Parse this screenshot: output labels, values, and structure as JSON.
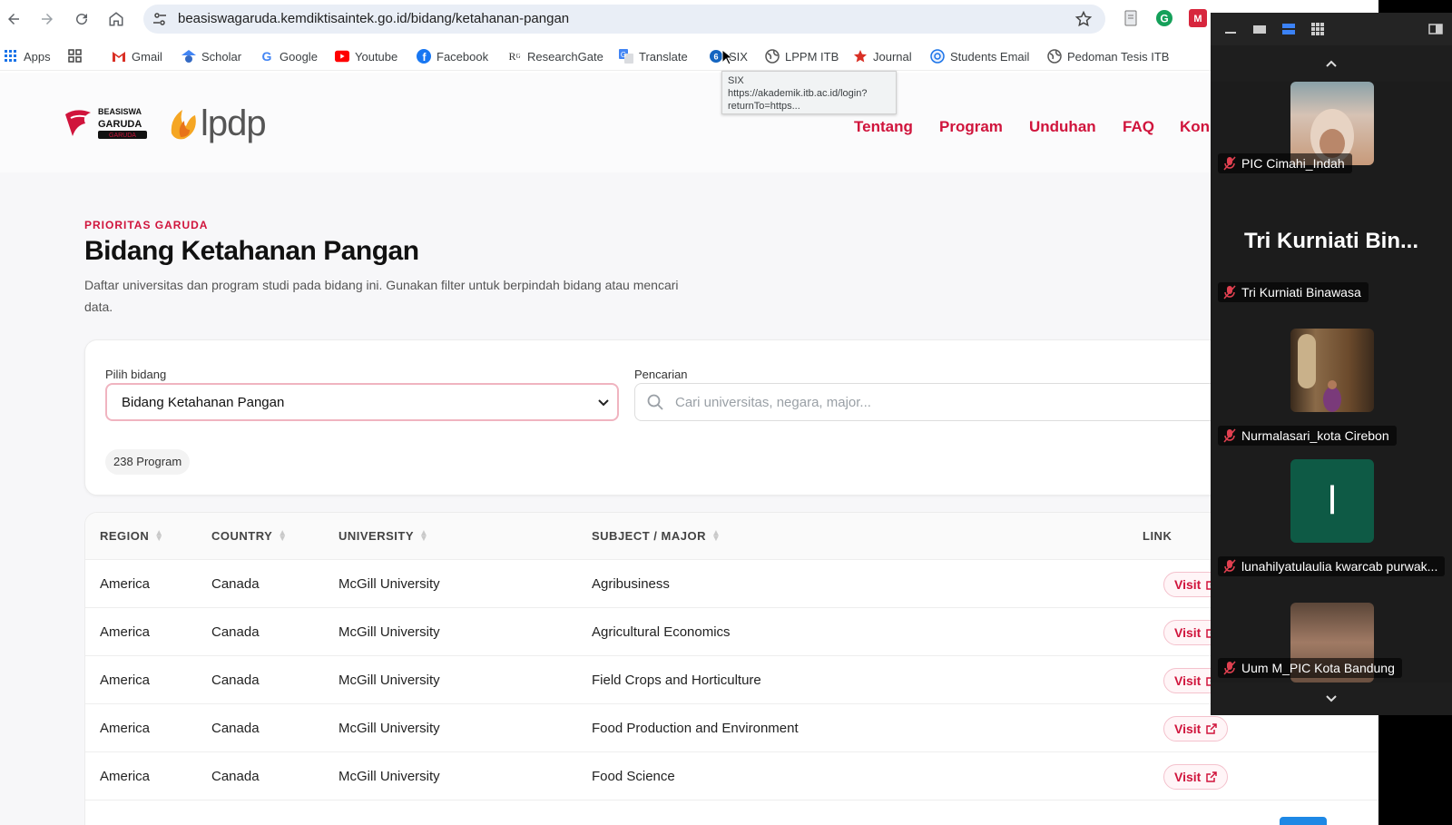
{
  "browser": {
    "url": "beasiswagaruda.kemdiktisaintek.go.id/bidang/ketahanan-pangan",
    "bookmarks": [
      {
        "label": "Apps",
        "icon": "apps-grid-icon"
      },
      {
        "label": "",
        "icon": "tab-groups-icon"
      },
      {
        "label": "Gmail",
        "icon": "gmail-icon"
      },
      {
        "label": "Scholar",
        "icon": "scholar-icon"
      },
      {
        "label": "Google",
        "icon": "google-icon"
      },
      {
        "label": "Youtube",
        "icon": "youtube-icon"
      },
      {
        "label": "Facebook",
        "icon": "facebook-icon"
      },
      {
        "label": "ResearchGate",
        "icon": "researchgate-icon"
      },
      {
        "label": "Translate",
        "icon": "translate-icon"
      },
      {
        "label": "SIX",
        "icon": "six-icon"
      },
      {
        "label": "LPPM ITB",
        "icon": "globe-icon"
      },
      {
        "label": "Journal",
        "icon": "star-icon"
      },
      {
        "label": "Students Email",
        "icon": "email-icon"
      },
      {
        "label": "Pedoman Tesis ITB",
        "icon": "globe-icon"
      }
    ],
    "tooltip": {
      "line1": "SIX",
      "line2": "https://akademik.itb.ac.id/login?",
      "line3": "returnTo=https..."
    }
  },
  "site": {
    "logo_garuda": {
      "line1": "BEASISWA",
      "line2": "GARUDA",
      "line3": "GARUDA"
    },
    "logo_lpdp": "lpdp",
    "nav": [
      "Tentang",
      "Program",
      "Unduhan",
      "FAQ",
      "Kon"
    ],
    "accent": "#d0143c"
  },
  "main": {
    "eyebrow": "PRIORITAS GARUDA",
    "title": "Bidang Ketahanan Pangan",
    "description": "Daftar universitas dan program studi pada bidang ini. Gunakan filter untuk berpindah bidang atau mencari data.",
    "filter": {
      "select_label": "Pilih bidang",
      "select_value": "Bidang Ketahanan Pangan",
      "search_label": "Pencarian",
      "search_placeholder": "Cari universitas, negara, major...",
      "search_value": "",
      "count": "238 Program"
    },
    "table": {
      "headers": [
        "REGION",
        "COUNTRY",
        "UNIVERSITY",
        "SUBJECT / MAJOR",
        "LINK"
      ],
      "visit_label": "Visit",
      "rows": [
        [
          "America",
          "Canada",
          "McGill University",
          "Agribusiness"
        ],
        [
          "America",
          "Canada",
          "McGill University",
          "Agricultural Economics"
        ],
        [
          "America",
          "Canada",
          "McGill University",
          "Field Crops and Horticulture"
        ],
        [
          "America",
          "Canada",
          "McGill University",
          "Food Production and Environment"
        ],
        [
          "America",
          "Canada",
          "McGill University",
          "Food Science"
        ]
      ]
    }
  },
  "call": {
    "participants": [
      {
        "name": "PIC Cimahi_Indah",
        "kind": "video"
      },
      {
        "name": "Tri Kurniati Binawasa",
        "kind": "name-only",
        "display": "Tri Kurniati Bin..."
      },
      {
        "name": "Nurmalasari_kota Cirebon",
        "kind": "video"
      },
      {
        "name": "lunahilyatulaulia kwarcab purwak...",
        "kind": "avatar",
        "initial": "l",
        "color": "#0e5a45"
      },
      {
        "name": "Uum M_PIC Kota Bandung",
        "kind": "video"
      }
    ]
  }
}
